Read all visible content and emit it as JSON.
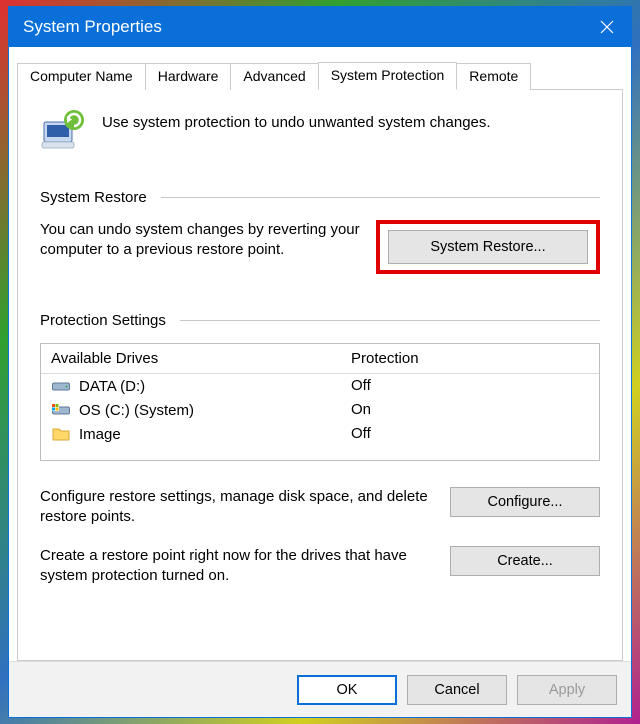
{
  "window": {
    "title": "System Properties"
  },
  "tabs": [
    {
      "label": "Computer Name"
    },
    {
      "label": "Hardware"
    },
    {
      "label": "Advanced"
    },
    {
      "label": "System Protection",
      "active": true
    },
    {
      "label": "Remote"
    }
  ],
  "intro_text": "Use system protection to undo unwanted system changes.",
  "sections": {
    "restore": {
      "title": "System Restore",
      "text": "You can undo system changes by reverting your computer to a previous restore point.",
      "button": "System Restore..."
    },
    "protection": {
      "title": "Protection Settings",
      "columns": {
        "drive": "Available Drives",
        "protection": "Protection"
      },
      "drives": [
        {
          "name": "DATA (D:)",
          "protection": "Off",
          "icon": "hdd"
        },
        {
          "name": "OS (C:) (System)",
          "protection": "On",
          "icon": "os"
        },
        {
          "name": "Image",
          "protection": "Off",
          "icon": "folder"
        }
      ],
      "configure_text": "Configure restore settings, manage disk space, and delete restore points.",
      "configure_button": "Configure...",
      "create_text": "Create a restore point right now for the drives that have system protection turned on.",
      "create_button": "Create..."
    }
  },
  "footer": {
    "ok": "OK",
    "cancel": "Cancel",
    "apply": "Apply"
  }
}
